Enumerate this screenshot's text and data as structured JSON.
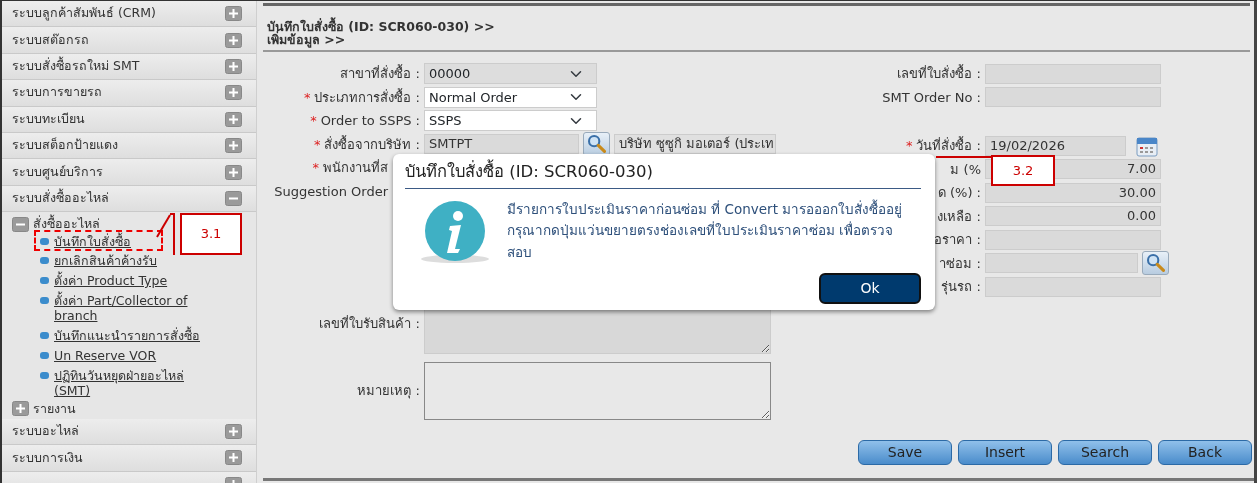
{
  "sidebar": {
    "sections": [
      {
        "label": "ระบบลูกค้าสัมพันธ์ (CRM)",
        "expanded": false
      },
      {
        "label": "ระบบสต๊อกรถ",
        "expanded": false
      },
      {
        "label": "ระบบสั่งซื้อรถใหม่ SMT",
        "expanded": false
      },
      {
        "label": "ระบบการขายรถ",
        "expanded": false
      },
      {
        "label": "ระบบทะเบียน",
        "expanded": false
      },
      {
        "label": "ระบบสต็อกป้ายแดง",
        "expanded": false
      },
      {
        "label": "ระบบศูนย์บริการ",
        "expanded": false
      },
      {
        "label": "ระบบสั่งซื้ออะไหล่",
        "expanded": true,
        "children": [
          {
            "label": "สั่งซื้ออะไหล่",
            "expanded": true,
            "children": [
              {
                "label": "บันทึกใบสั่งซื้อ",
                "highlighted": true
              },
              {
                "label": "ยกเลิกสินค้าค้างรับ"
              },
              {
                "label": "ตั้งค่า Product Type"
              },
              {
                "label": "ตั้งค่า Part/Collector of branch"
              },
              {
                "label": "บันทึกแนะนำรายการสั่งซื้อ"
              },
              {
                "label": "Un Reserve VOR"
              },
              {
                "label": "ปฏิทินวันหยุดฝ่ายอะไหล่ (SMT)"
              }
            ]
          },
          {
            "label": "รายงาน",
            "expanded": false
          }
        ]
      },
      {
        "label": "ระบบอะไหล่",
        "expanded": false
      },
      {
        "label": "ระบบการเงิน",
        "expanded": false
      },
      {
        "expanded": false
      }
    ]
  },
  "header": {
    "breadcrumb": [
      "บันทึกใบสั่งซื้อ (ID: SCR060-030) >>",
      "เพิ่มข้อมูล >>"
    ]
  },
  "form": {
    "left": [
      [
        {
          "label": "สาขาที่สั่งซื้อ :",
          "kind": "select",
          "value": "00000",
          "disabled": true
        },
        {
          "label": "ประเภทการสั่งซื้อ :",
          "mark": "*",
          "kind": "select",
          "value": "Normal Order",
          "disabled": false
        },
        {
          "label": "Order to SSPS :",
          "mark": "*",
          "kind": "select",
          "value": "SSPS",
          "disabled": false
        },
        {
          "label": "สั่งซื้อจากบริษัท :",
          "mark": "*",
          "kind": "lookup",
          "value": "SMTPT",
          "extra": "บริษัท ซูซูกิ มอเตอร์ (ประเท",
          "disabled": true
        },
        {
          "label": "พนักงานที่ส",
          "mark": "*",
          "kind": "none"
        },
        {
          "label": "Suggestion Order",
          "kind": "none"
        }
      ],
      [
        {
          "label": "เลขที่ใบรับสินค้า :",
          "kind": "textarea",
          "disabled": true
        },
        {
          "label": "หมายเหตุ :",
          "kind": "textarea",
          "disabled": false
        }
      ]
    ],
    "right": [
      [
        {
          "label": "เลขที่ใบสั่งซื้อ :",
          "kind": "text",
          "disabled": true
        },
        {
          "label": "SMT Order No :",
          "kind": "text",
          "disabled": true
        }
      ],
      [
        {
          "label": "วันที่สั่งซื้อ :",
          "mark": "*",
          "kind": "date",
          "value": "19/02/2026",
          "disabled": true
        },
        {
          "label": "ม (%",
          "kind": "number",
          "value": "7.00",
          "disabled": true
        },
        {
          "label": "ด (%) :",
          "kind": "number",
          "value": "30.00",
          "disabled": true
        },
        {
          "label": "งเหลือ :",
          "kind": "number",
          "value": "0.00",
          "disabled": true
        },
        {
          "label": "อราคา :",
          "kind": "text",
          "disabled": true
        },
        {
          "label": "าซ่อม :",
          "kind": "lookup",
          "disabled": true
        },
        {
          "label": "รุ่นรถ :",
          "kind": "text",
          "disabled": true
        }
      ]
    ]
  },
  "buttons": [
    "Save",
    "Insert",
    "Search",
    "Back"
  ],
  "dialog": {
    "title": "บันทึกใบสั่งซื้อ (ID: SCR060-030)",
    "message": "มีรายการใบประเมินราคาก่อนซ่อม ที่ Convert มารอออกใบสั่งซื้ออยู่ กรุณากดปุ่มแว่นขยายตรงช่องเลขที่ใบประเมินราคาซ่อม เพื่อตรวจสอบ",
    "button": "Ok"
  },
  "callouts": [
    {
      "label": "3.1"
    },
    {
      "label": "3.2"
    }
  ]
}
